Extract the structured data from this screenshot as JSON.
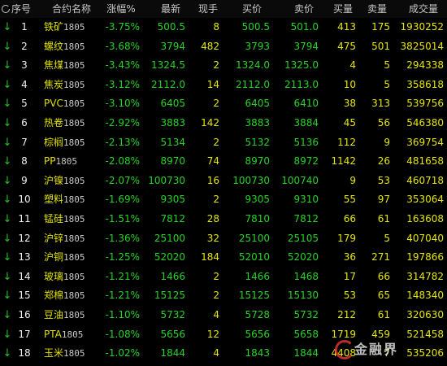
{
  "header": {
    "seq": "序号",
    "name": "合约名称",
    "change": "涨幅%",
    "last": "最新",
    "volume": "现手",
    "bid": "买价",
    "ask": "卖价",
    "bid_vol": "买量",
    "ask_vol": "卖量",
    "total": "成交量"
  },
  "rows": [
    {
      "seq": "1",
      "name_cn": "铁矿",
      "name_num": "1805",
      "change": "-3.75%",
      "last": "500.5",
      "volume": "8",
      "bid": "500.5",
      "ask": "501.0",
      "bid_vol": "413",
      "ask_vol": "175",
      "total": "1930252"
    },
    {
      "seq": "2",
      "name_cn": "螺纹",
      "name_num": "1805",
      "change": "-3.68%",
      "last": "3794",
      "volume": "482",
      "bid": "3793",
      "ask": "3794",
      "bid_vol": "475",
      "ask_vol": "501",
      "total": "3825014"
    },
    {
      "seq": "3",
      "name_cn": "焦煤",
      "name_num": "1805",
      "change": "-3.43%",
      "last": "1324.5",
      "volume": "2",
      "bid": "1324.0",
      "ask": "1325.0",
      "bid_vol": "4",
      "ask_vol": "5",
      "total": "294338"
    },
    {
      "seq": "4",
      "name_cn": "焦炭",
      "name_num": "1805",
      "change": "-3.12%",
      "last": "2112.0",
      "volume": "14",
      "bid": "2112.0",
      "ask": "2113.0",
      "bid_vol": "10",
      "ask_vol": "5",
      "total": "358618"
    },
    {
      "seq": "5",
      "name_cn": "PVC",
      "name_num": "1805",
      "change": "-3.10%",
      "last": "6405",
      "volume": "2",
      "bid": "6405",
      "ask": "6410",
      "bid_vol": "38",
      "ask_vol": "313",
      "total": "539756"
    },
    {
      "seq": "6",
      "name_cn": "热卷",
      "name_num": "1805",
      "change": "-2.92%",
      "last": "3883",
      "volume": "142",
      "bid": "3883",
      "ask": "3884",
      "bid_vol": "45",
      "ask_vol": "56",
      "total": "546380"
    },
    {
      "seq": "7",
      "name_cn": "棕榈",
      "name_num": "1805",
      "change": "-2.13%",
      "last": "5134",
      "volume": "2",
      "bid": "5132",
      "ask": "5136",
      "bid_vol": "112",
      "ask_vol": "9",
      "total": "369754"
    },
    {
      "seq": "8",
      "name_cn": "PP",
      "name_num": "1805",
      "change": "-2.08%",
      "last": "8970",
      "volume": "74",
      "bid": "8970",
      "ask": "8972",
      "bid_vol": "1142",
      "ask_vol": "26",
      "total": "481658"
    },
    {
      "seq": "9",
      "name_cn": "沪镍",
      "name_num": "1805",
      "change": "-2.07%",
      "last": "100730",
      "volume": "16",
      "bid": "100730",
      "ask": "100740",
      "bid_vol": "9",
      "ask_vol": "53",
      "total": "460718"
    },
    {
      "seq": "10",
      "name_cn": "塑料",
      "name_num": "1805",
      "change": "-1.69%",
      "last": "9305",
      "volume": "2",
      "bid": "9305",
      "ask": "9310",
      "bid_vol": "55",
      "ask_vol": "97",
      "total": "353064"
    },
    {
      "seq": "11",
      "name_cn": "锰硅",
      "name_num": "1805",
      "change": "-1.51%",
      "last": "7812",
      "volume": "28",
      "bid": "7810",
      "ask": "7812",
      "bid_vol": "66",
      "ask_vol": "61",
      "total": "163608"
    },
    {
      "seq": "12",
      "name_cn": "沪锌",
      "name_num": "1805",
      "change": "-1.36%",
      "last": "25100",
      "volume": "32",
      "bid": "25100",
      "ask": "25105",
      "bid_vol": "179",
      "ask_vol": "5",
      "total": "407040"
    },
    {
      "seq": "13",
      "name_cn": "沪铜",
      "name_num": "1805",
      "change": "-1.25%",
      "last": "52020",
      "volume": "184",
      "bid": "52010",
      "ask": "52020",
      "bid_vol": "36",
      "ask_vol": "271",
      "total": "197866"
    },
    {
      "seq": "14",
      "name_cn": "玻璃",
      "name_num": "1805",
      "change": "-1.21%",
      "last": "1466",
      "volume": "2",
      "bid": "1466",
      "ask": "1468",
      "bid_vol": "17",
      "ask_vol": "66",
      "total": "314782"
    },
    {
      "seq": "15",
      "name_cn": "郑棉",
      "name_num": "1805",
      "change": "-1.21%",
      "last": "15125",
      "volume": "2",
      "bid": "15125",
      "ask": "15130",
      "bid_vol": "53",
      "ask_vol": "65",
      "total": "148340"
    },
    {
      "seq": "16",
      "name_cn": "豆油",
      "name_num": "1805",
      "change": "-1.10%",
      "last": "5732",
      "volume": "4",
      "bid": "5728",
      "ask": "5732",
      "bid_vol": "212",
      "ask_vol": "61",
      "total": "320630"
    },
    {
      "seq": "17",
      "name_cn": "PTA",
      "name_num": "1805",
      "change": "-1.08%",
      "last": "5656",
      "volume": "12",
      "bid": "5656",
      "ask": "5658",
      "bid_vol": "1719",
      "ask_vol": "459",
      "total": "521458"
    },
    {
      "seq": "18",
      "name_cn": "玉米",
      "name_num": "1805",
      "change": "-1.02%",
      "last": "1844",
      "volume": "4",
      "bid": "1843",
      "ask": "1844",
      "bid_vol": "4408",
      "ask_vol": "7",
      "total": "535206"
    }
  ],
  "icons": {
    "row_marker": "down-arrow-icon",
    "header_marker": "sort-circle-icon"
  },
  "colors": {
    "background": "#000000",
    "down": "#27d227",
    "name": "#e0e000",
    "volume": "#e6e600",
    "text": "#f2f2f2"
  },
  "watermark": {
    "text": "金融界"
  }
}
